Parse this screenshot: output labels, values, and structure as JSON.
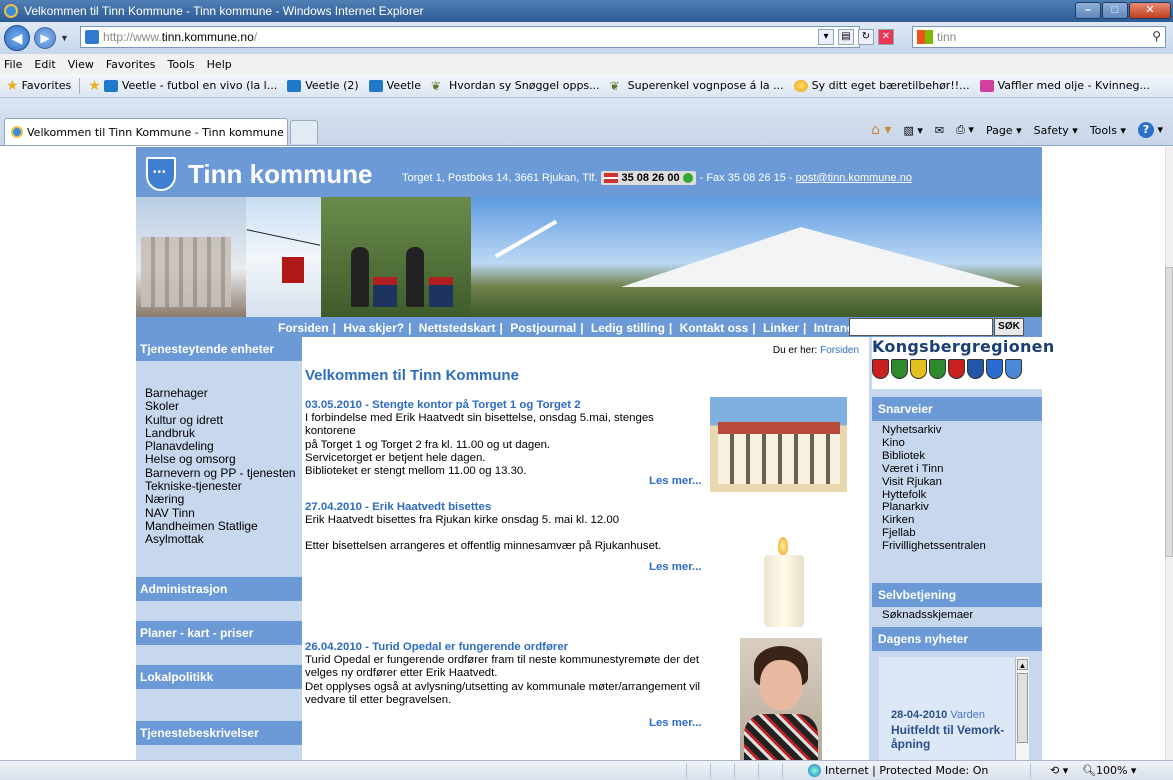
{
  "window": {
    "title": "Velkommen til Tinn Kommune - Tinn kommune - Windows Internet Explorer"
  },
  "address": {
    "url_prefix": "http://www.",
    "url_domain": "tinn.kommune.no",
    "url_suffix": "/",
    "search_text": "tinn"
  },
  "menu": [
    "File",
    "Edit",
    "View",
    "Favorites",
    "Tools",
    "Help"
  ],
  "favorites": {
    "label": "Favorites",
    "items": [
      "Veetle - futbol en vivo (la l...",
      "Veetle (2)",
      "Veetle",
      "Hvordan sy Snøggel opps...",
      "Superenkel vognpose á la ...",
      "Sy ditt eget bæretilbehør!!...",
      "Vaffler med olje - Kvinneg..."
    ]
  },
  "tab": {
    "label": "Velkommen til Tinn Kommune - Tinn kommune"
  },
  "commandbar": {
    "page": "Page",
    "safety": "Safety",
    "tools": "Tools"
  },
  "site": {
    "name": "Tinn kommune",
    "address": "Torget 1, Postboks 14, 3661 Rjukan, Tlf.",
    "phone": "35 08 26 00",
    "fax": "- Fax 35 08 26 15 -",
    "email": "post@tinn.kommune.no"
  },
  "nav": {
    "links": [
      "Forsiden",
      "Hva skjer?",
      "Nettstedskart",
      "Postjournal",
      "Ledig stilling",
      "Kontakt oss",
      "Linker",
      "Intranett"
    ],
    "search_button": "SØK"
  },
  "left": {
    "header": "Tjenesteytende enheter",
    "items": [
      "Barnehager",
      "Skoler",
      "Kultur og idrett",
      "Landbruk",
      "Planavdeling",
      "Helse og omsorg",
      "Barnevern og PP - tjenesten",
      "Tekniske-tjenester",
      "Næring",
      "NAV Tinn",
      "Mandheimen Statlige",
      "Asylmottak"
    ],
    "sections": [
      "Administrasjon",
      "Planer - kart - priser",
      "Lokalpolitikk",
      "Tjenestebeskrivelser"
    ]
  },
  "main": {
    "breadcrumb_label": "Du er her:",
    "breadcrumb_link": "Forsiden",
    "title": "Velkommen til Tinn Kommune",
    "read_more": "Les mer...",
    "news": [
      {
        "date": "03.05.2010 - Stengte kontor på Torget 1 og Torget 2",
        "lines": [
          "I forbindelse med Erik Haatvedt sin bisettelse, onsdag 5.mai, stenges kontorene",
          "på Torget 1 og Torget 2 fra kl. 11.00 og ut dagen.",
          "Servicetorget er betjent hele dagen.",
          "Biblioteket er stengt mellom 11.00 og 13.30."
        ]
      },
      {
        "date": "27.04.2010 - Erik Haatvedt bisettes",
        "lines": [
          "Erik Haatvedt bisettes fra Rjukan kirke onsdag 5. mai kl. 12.00",
          "",
          "Etter bisettelsen arrangeres et offentlig minnesamvær på Rjukanhuset."
        ]
      },
      {
        "date": "26.04.2010 - Turid Opedal er fungerende ordfører",
        "lines": [
          "Turid Opedal er fungerende ordfører fram til neste kommunestyremøte der det",
          "velges ny ordfører etter Erik Haatvedt.",
          "Det opplyses også at avlysning/utsetting av kommunale møter/arrangement vil",
          "vedvare til etter begravelsen."
        ]
      }
    ]
  },
  "right": {
    "region_title": "Kongsbergregionen",
    "shortcuts_header": "Snarveier",
    "shortcuts": [
      "Nyhetsarkiv",
      "Kino",
      "Bibliotek",
      "Været i Tinn",
      "Visit Rjukan",
      "Hyttefolk",
      "Planarkiv",
      "Kirken",
      "Fjellab",
      "Frivillighetssentralen"
    ],
    "selfservice_header": "Selvbetjening",
    "selfservice": [
      "Søknadsskjemaer"
    ],
    "news_header": "Dagens nyheter",
    "news_date": "28-04-2010",
    "news_source": "Varden",
    "news_headline": "Huitfeldt til Vemork-åpning"
  },
  "status": {
    "zone": "Internet | Protected Mode: On",
    "zoom": "100%"
  },
  "colors": {
    "site_blue": "#6b9ad6",
    "link_blue": "#2d6cc0",
    "panel_light": "#c7d8ee"
  }
}
